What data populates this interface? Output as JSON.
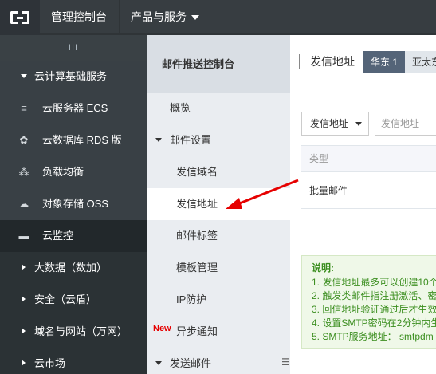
{
  "topbar": {
    "console_label": "管理控制台",
    "products_label": "产品与服务"
  },
  "sidebar": {
    "collapse_glyph": "III",
    "cloud_group_label": "云计算基础服务",
    "items": [
      {
        "label": "云服务器 ECS",
        "icon": "server-icon"
      },
      {
        "label": "云数据库 RDS 版",
        "icon": "database-icon"
      },
      {
        "label": "负载均衡",
        "icon": "load-balancer-icon"
      },
      {
        "label": "对象存储 OSS",
        "icon": "cloud-storage-icon"
      },
      {
        "label": "云监控",
        "icon": "monitor-icon"
      }
    ],
    "groups": [
      {
        "label": "大数据（数加）"
      },
      {
        "label": "安全（云盾）"
      },
      {
        "label": "域名与网站（万网）"
      },
      {
        "label": "云市场"
      }
    ]
  },
  "midbar": {
    "title": "邮件推送控制台",
    "overview": "概览",
    "mail_settings": "邮件设置",
    "items": [
      {
        "label": "发信域名"
      },
      {
        "label": "发信地址"
      },
      {
        "label": "邮件标签"
      },
      {
        "label": "模板管理"
      },
      {
        "label": "IP防护"
      },
      {
        "label": "异步通知"
      }
    ],
    "new_badge": "New",
    "send_mail": "发送邮件",
    "toggle_glyph": "☰"
  },
  "main": {
    "page_title": "发信地址",
    "region_active": "华东 1",
    "region_inactive": "亚太东",
    "filter_select_value": "发信地址",
    "filter_input_placeholder": "发信地址",
    "table_header_type": "类型",
    "table_row_type": "批量邮件",
    "notes_title": "说明:",
    "notes": [
      "1. 发信地址最多可以创建10个",
      "2. 触发类邮件指注册激活、密",
      "3. 回信地址验证通过后才生效",
      "4. 设置SMTP密码在2分钟内生",
      "5. SMTP服务地址： smtpdm"
    ]
  },
  "colors": {
    "topbar": "#373d41",
    "sidebar": "#394045",
    "midbar": "#eaedf1",
    "region_active": "#546478",
    "notes_text": "#3b8e1f",
    "arrow": "#e60000"
  }
}
